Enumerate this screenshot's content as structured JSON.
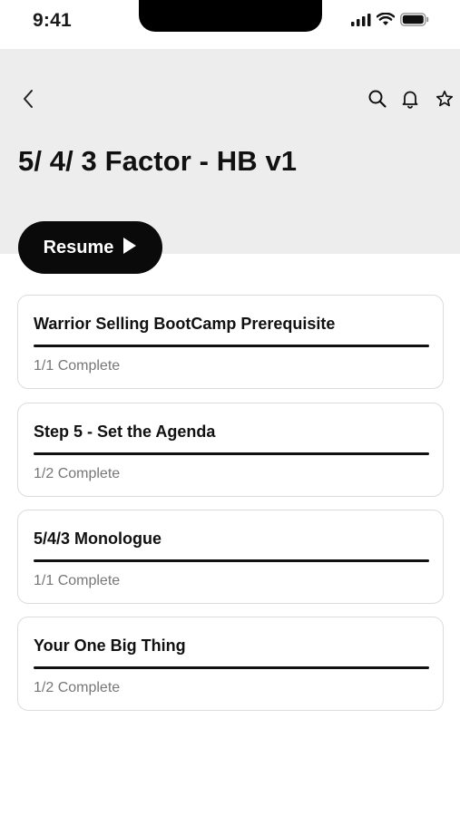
{
  "status_bar": {
    "time": "9:41"
  },
  "header": {
    "title": "5/ 4/ 3 Factor - HB v1",
    "icons": [
      "back-icon",
      "search-icon",
      "bell-icon",
      "star-icon"
    ]
  },
  "resume": {
    "label": "Resume"
  },
  "colors": {
    "header_bg": "#ededed",
    "button_bg": "#0a0a0a",
    "progress_fill": "#111111",
    "status_text": "#777777"
  },
  "steps": [
    {
      "title": "Warrior Selling BootCamp Prerequisite",
      "status": "1/1 Complete",
      "progress": 1.0
    },
    {
      "title": "Step 5 - Set the Agenda",
      "status": "1/2 Complete",
      "progress": 1.0
    },
    {
      "title": "5/4/3 Monologue",
      "status": "1/1 Complete",
      "progress": 1.0
    },
    {
      "title": "Your One Big Thing",
      "status": "1/2 Complete",
      "progress": 1.0
    }
  ]
}
